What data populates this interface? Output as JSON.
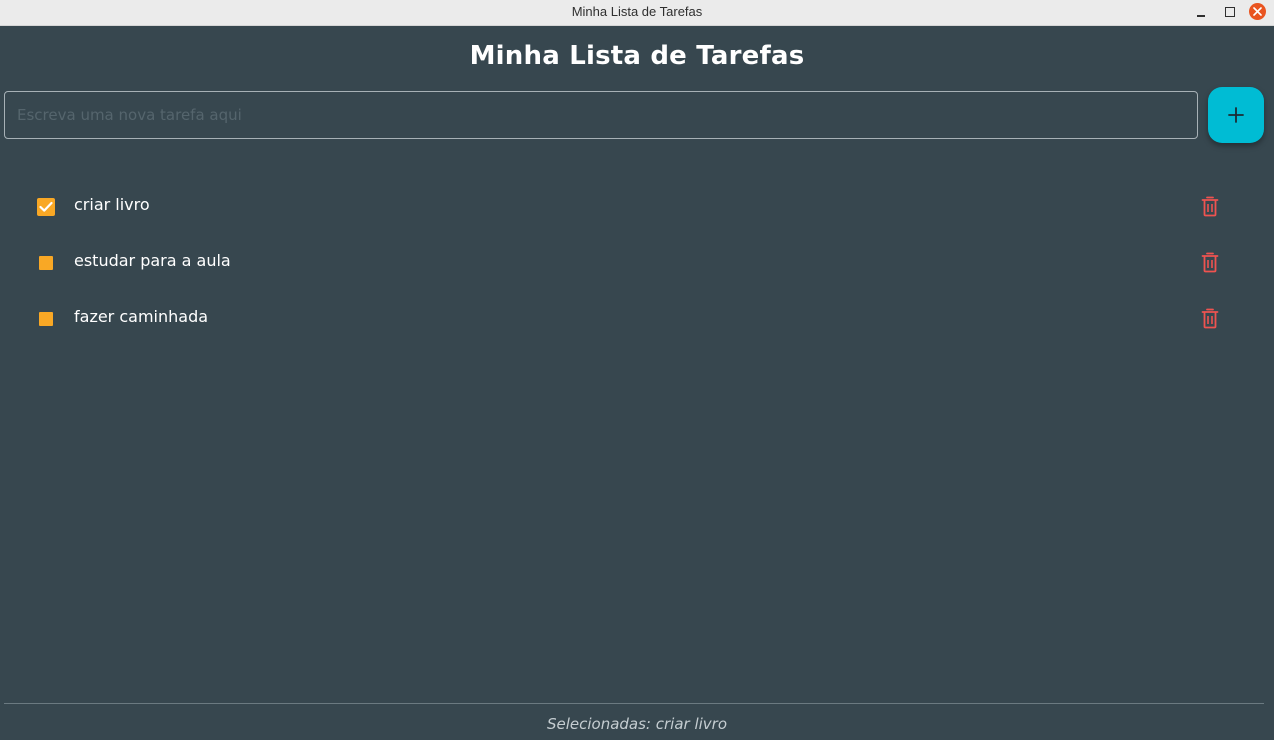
{
  "window": {
    "title": "Minha Lista de Tarefas",
    "controls": [
      "minimize-icon",
      "maximize-icon",
      "close-icon"
    ],
    "close_color": "#e95420"
  },
  "header": {
    "title": "Minha Lista de Tarefas"
  },
  "new_task": {
    "value": "",
    "placeholder": "Escreva uma nova tarefa aqui",
    "add_icon": "plus-icon",
    "add_button_color": "#00bcd4"
  },
  "tasks": [
    {
      "label": "criar livro",
      "checked": true
    },
    {
      "label": "estudar para a aula",
      "checked": false
    },
    {
      "label": "fazer caminhada",
      "checked": false
    }
  ],
  "task_icons": {
    "delete": "trash-icon",
    "check": "check-icon"
  },
  "colors": {
    "background": "#37474f",
    "checkbox": "#f9a825",
    "delete": "#ef5350",
    "accent": "#00bcd4"
  },
  "footer": {
    "status": "Selecionadas: criar livro"
  }
}
